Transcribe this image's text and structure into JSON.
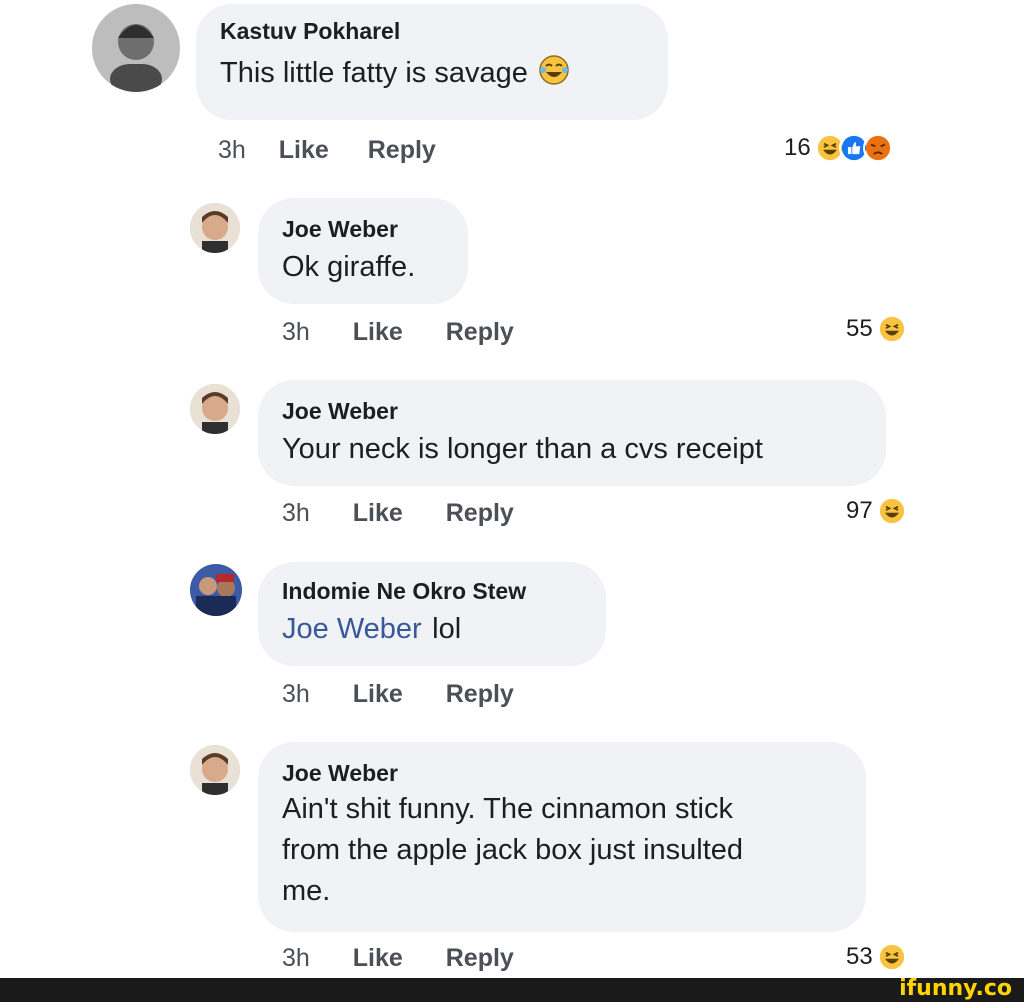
{
  "comments": [
    {
      "author": "Kastuv Pokharel",
      "text": "This little fatty is savage",
      "emoji": "laughing-tears-emoji",
      "time": "3h",
      "like": "Like",
      "reply": "Reply",
      "reaction_count": "16",
      "reaction_icons": [
        "haha-icon",
        "like-icon",
        "angry-icon"
      ]
    },
    {
      "author": "Joe Weber",
      "text": "Ok giraffe.",
      "time": "3h",
      "like": "Like",
      "reply": "Reply",
      "reaction_count": "55",
      "reaction_icons": [
        "haha-icon"
      ]
    },
    {
      "author": "Joe Weber",
      "text": "Your neck is longer than a cvs receipt",
      "time": "3h",
      "like": "Like",
      "reply": "Reply",
      "reaction_count": "97",
      "reaction_icons": [
        "haha-icon"
      ]
    },
    {
      "author": "Indomie Ne Okro Stew",
      "mention": "Joe Weber",
      "text": "lol",
      "time": "3h",
      "like": "Like",
      "reply": "Reply"
    },
    {
      "author": "Joe Weber",
      "text_lines": [
        "Ain't shit funny. The cinnamon stick",
        "from the apple jack box just insulted",
        "me."
      ],
      "time": "3h",
      "like": "Like",
      "reply": "Reply",
      "reaction_count": "53",
      "reaction_icons": [
        "haha-icon"
      ]
    }
  ],
  "watermark": "ifunny.co",
  "colors": {
    "bubble": "#f0f2f5",
    "mention": "#385898",
    "haha": "#f7c340",
    "like": "#1877f2",
    "angry": "#e9710f"
  }
}
